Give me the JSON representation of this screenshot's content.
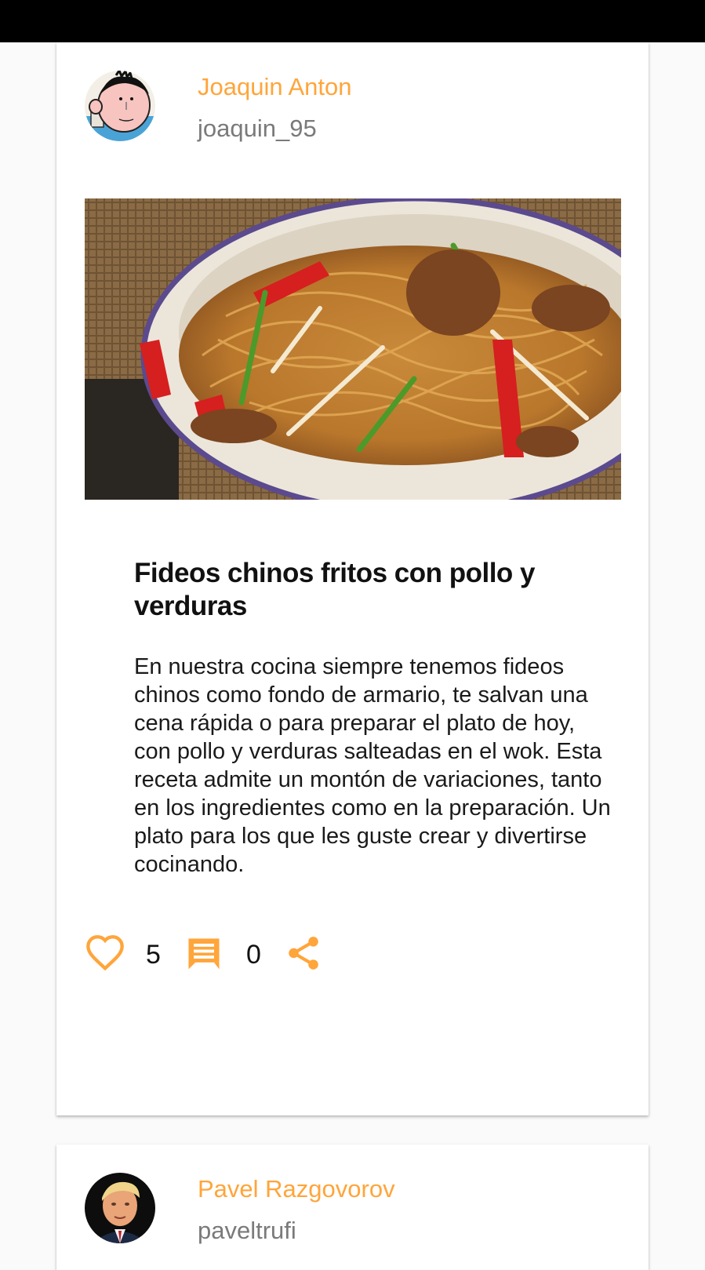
{
  "colors": {
    "accent": "#FFA53A",
    "handle": "#7a7a7a"
  },
  "posts": [
    {
      "author_name": "Joaquin Anton",
      "author_handle": "joaquin_95",
      "title": "Fideos chinos fritos con pollo y verduras",
      "body": "En nuestra cocina siempre tenemos fideos chinos como fondo de armario, te salvan una cena rápida o para preparar el plato de hoy, con pollo y verduras salteadas en el wok. Esta receta admite un montón de variaciones, tanto en los ingredientes como en la preparación. Un plato para los que les guste crear y divertirse cocinando.",
      "likes": "5",
      "comments": "0",
      "icons": {
        "like": "heart-outline-icon",
        "comment": "comment-icon",
        "share": "share-icon"
      }
    },
    {
      "author_name": "Pavel Razgovorov",
      "author_handle": "paveltrufi"
    }
  ]
}
